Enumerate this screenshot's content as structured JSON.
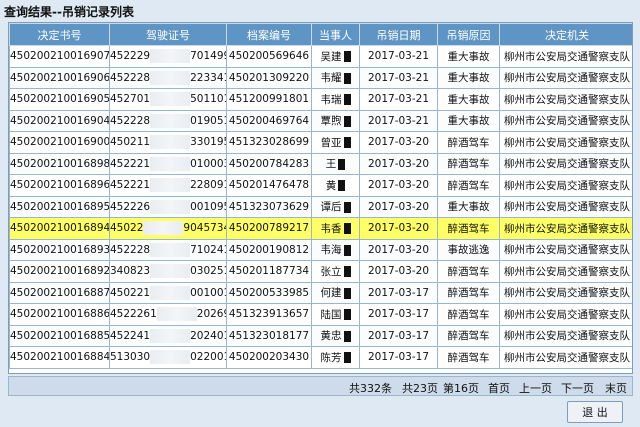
{
  "window": {
    "title": "查询结果--吊销记录列表"
  },
  "columns": [
    "决定书号",
    "驾驶证号",
    "档案编号",
    "当事人",
    "吊销日期",
    "吊销原因",
    "决定机关"
  ],
  "rows": [
    {
      "decision_no": "450200210016907",
      "license_pre": "452229",
      "license_suf": "7014998",
      "file_no": "450200569646",
      "party": "吴建",
      "date": "2017-03-21",
      "reason": "重大事故",
      "authority": "柳州市公安局交通警察支队",
      "selected": false
    },
    {
      "decision_no": "450200210016906",
      "license_pre": "452228",
      "license_suf": "2233413",
      "file_no": "450201309220",
      "party": "韦耀",
      "date": "2017-03-21",
      "reason": "重大事故",
      "authority": "柳州市公安局交通警察支队",
      "selected": false
    },
    {
      "decision_no": "450200210016905",
      "license_pre": "452701",
      "license_suf": "5011010",
      "file_no": "451200991801",
      "party": "韦瑞",
      "date": "2017-03-21",
      "reason": "重大事故",
      "authority": "柳州市公安局交通警察支队",
      "selected": false
    },
    {
      "decision_no": "450200210016904",
      "license_pre": "452228",
      "license_suf": "0190511",
      "file_no": "450200469764",
      "party": "覃煦",
      "date": "2017-03-21",
      "reason": "重大事故",
      "authority": "柳州市公安局交通警察支队",
      "selected": false
    },
    {
      "decision_no": "450200210016900",
      "license_pre": "450211",
      "license_suf": "3301955",
      "file_no": "451323028699",
      "party": "曾亚",
      "date": "2017-03-20",
      "reason": "醉酒驾车",
      "authority": "柳州市公安局交通警察支队",
      "selected": false
    },
    {
      "decision_no": "450200210016898",
      "license_pre": "452221",
      "license_suf": "0100033",
      "file_no": "450200784283",
      "party": "王",
      "date": "2017-03-20",
      "reason": "醉酒驾车",
      "authority": "柳州市公安局交通警察支队",
      "selected": false
    },
    {
      "decision_no": "450200210016896",
      "license_pre": "452221",
      "license_suf": "2280915",
      "file_no": "450201476478",
      "party": "黄",
      "date": "2017-03-20",
      "reason": "醉酒驾车",
      "authority": "柳州市公安局交通警察支队",
      "selected": false
    },
    {
      "decision_no": "450200210016895",
      "license_pre": "452226",
      "license_suf": "0010955",
      "file_no": "451323073629",
      "party": "谭后",
      "date": "2017-03-20",
      "reason": "重大事故",
      "authority": "柳州市公安局交通警察支队",
      "selected": false
    },
    {
      "decision_no": "450200210016894",
      "license_pre": "45022",
      "license_suf": "9045734",
      "file_no": "450200789217",
      "party": "韦香",
      "date": "2017-03-20",
      "reason": "醉酒驾车",
      "authority": "柳州市公安局交通警察支队",
      "selected": true
    },
    {
      "decision_no": "450200210016893",
      "license_pre": "452228",
      "license_suf": "7102418",
      "file_no": "450200190812",
      "party": "韦海",
      "date": "2017-03-20",
      "reason": "事故逃逸",
      "authority": "柳州市公安局交通警察支队",
      "selected": false
    },
    {
      "decision_no": "450200210016892",
      "license_pre": "340823",
      "license_suf": "0302511",
      "file_no": "450201187734",
      "party": "张立",
      "date": "2017-03-20",
      "reason": "醉酒驾车",
      "authority": "柳州市公安局交通警察支队",
      "selected": false
    },
    {
      "decision_no": "450200210016887",
      "license_pre": "450221",
      "license_suf": "0010010",
      "file_no": "450200533985",
      "party": "何建",
      "date": "2017-03-17",
      "reason": "醉酒驾车",
      "authority": "柳州市公安局交通警察支队",
      "selected": false
    },
    {
      "decision_no": "450200210016886",
      "license_pre": "4522261",
      "license_suf": "2026919",
      "file_no": "451323913657",
      "party": "陆国",
      "date": "2017-03-17",
      "reason": "醉酒驾车",
      "authority": "柳州市公安局交通警察支队",
      "selected": false
    },
    {
      "decision_no": "450200210016885",
      "license_pre": "452241",
      "license_suf": "2024011",
      "file_no": "451323018177",
      "party": "黄忠",
      "date": "2017-03-17",
      "reason": "醉酒驾车",
      "authority": "柳州市公安局交通警察支队",
      "selected": false
    },
    {
      "decision_no": "450200210016884",
      "license_pre": "513030",
      "license_suf": "0220012",
      "file_no": "450200203430",
      "party": "陈芳",
      "date": "2017-03-17",
      "reason": "醉酒驾车",
      "authority": "柳州市公安局交通警察支队",
      "selected": false
    }
  ],
  "pager": {
    "total": "共332条",
    "pages": "共23页",
    "current": "第16页",
    "first": "首页",
    "prev": "上一页",
    "next": "下一页",
    "last": "末页"
  },
  "exit_label": "退 出",
  "colors": {
    "header_bg": "#5f95c4",
    "selected_row": "#ffff66",
    "window_bg": "#dfe9f3"
  }
}
